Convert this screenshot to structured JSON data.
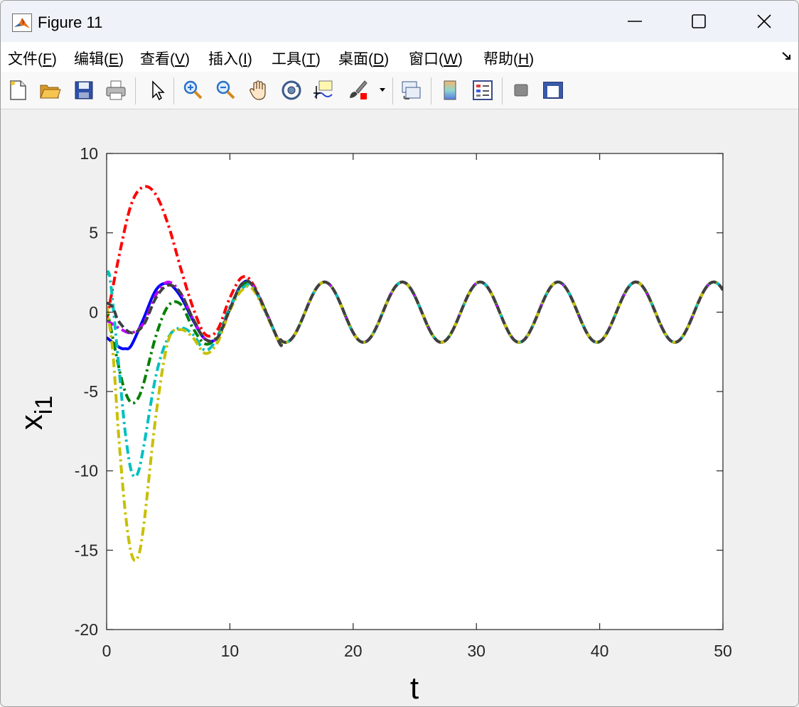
{
  "window": {
    "title": "Figure 11",
    "menu": [
      {
        "label": "文件(",
        "key": "F",
        "suffix": ")"
      },
      {
        "label": "编辑(",
        "key": "E",
        "suffix": ")"
      },
      {
        "label": "查看(",
        "key": "V",
        "suffix": ")"
      },
      {
        "label": "插入(",
        "key": "I",
        "suffix": ")"
      },
      {
        "label": "工具(",
        "key": "T",
        "suffix": ")"
      },
      {
        "label": "桌面(",
        "key": "D",
        "suffix": ")"
      },
      {
        "label": "窗口(",
        "key": "W",
        "suffix": ")"
      },
      {
        "label": "帮助(",
        "key": "H",
        "suffix": ")"
      }
    ],
    "toolbar_icons": [
      "new-figure-icon",
      "open-folder-icon",
      "save-icon",
      "print-icon",
      "pointer-icon",
      "zoom-in-icon",
      "zoom-out-icon",
      "pan-hand-icon",
      "rotate-3d-icon",
      "data-cursor-icon",
      "brush-icon",
      "link-plot-icon",
      "colorbar-icon",
      "legend-icon",
      "hide-plot-tools-icon",
      "show-plot-tools-icon"
    ]
  },
  "chart_data": {
    "type": "line",
    "title": "",
    "xlabel": "t",
    "ylabel": "x",
    "ylabel_subscript": "i1",
    "xlim": [
      0,
      50
    ],
    "ylim": [
      -20,
      10
    ],
    "xticks": [
      "0",
      "10",
      "20",
      "30",
      "40",
      "50"
    ],
    "yticks": [
      "10",
      "5",
      "0",
      "-5",
      "-10",
      "-15",
      "-20"
    ],
    "grid": false,
    "legend": "none",
    "reference_signal": {
      "amplitude": 1.9,
      "angular_frequency": 0.995,
      "phase": -3.45
    },
    "series": [
      {
        "color": "#ff0000",
        "style": "dash-dot",
        "x": [
          0,
          1,
          2,
          3,
          4,
          5,
          6,
          7,
          8,
          9,
          10,
          11,
          12,
          14
        ],
        "y": [
          -0.5,
          3.5,
          6.8,
          7.9,
          7.4,
          5.5,
          2.8,
          0.3,
          -1.4,
          -1.1,
          0.9,
          2.2,
          1.6,
          -1.9
        ]
      },
      {
        "color": "#0000ff",
        "style": "solid",
        "x": [
          0,
          1,
          1.5,
          2,
          3,
          4,
          5,
          6,
          7,
          8,
          9,
          10,
          11,
          12,
          14
        ],
        "y": [
          -1.6,
          -2.2,
          -2.3,
          -2.1,
          -0.4,
          1.4,
          1.8,
          1.0,
          -0.5,
          -1.7,
          -1.6,
          0.2,
          1.8,
          1.5,
          -1.9
        ]
      },
      {
        "color": "#c000ff",
        "style": "dash-dot",
        "x": [
          0,
          1,
          2,
          3,
          4,
          5,
          6,
          7,
          8,
          9,
          10,
          11,
          12,
          14
        ],
        "y": [
          -0.5,
          -1.0,
          -1.3,
          -0.7,
          1.1,
          1.9,
          1.2,
          -0.4,
          -1.7,
          -1.6,
          0.2,
          1.8,
          1.5,
          -1.9
        ]
      },
      {
        "color": "#008000",
        "style": "dash-dot",
        "x": [
          0,
          1,
          1.5,
          2,
          2.5,
          3,
          4,
          5,
          6,
          7,
          8,
          9,
          10,
          11,
          12,
          14
        ],
        "y": [
          0.3,
          -3.5,
          -5.0,
          -5.7,
          -5.5,
          -4.5,
          -1.5,
          0.4,
          0.5,
          -1.0,
          -2.0,
          -1.5,
          0.3,
          1.7,
          1.5,
          -1.9
        ]
      },
      {
        "color": "#00c0c0",
        "style": "dash-dot",
        "x": [
          0,
          0.3,
          1,
          1.5,
          2,
          2.5,
          3,
          4,
          5,
          6,
          7,
          8,
          9,
          10,
          11,
          12,
          14
        ],
        "y": [
          2.4,
          2.0,
          -3.5,
          -7.5,
          -10.0,
          -10.2,
          -8.5,
          -4.0,
          -1.6,
          -1.0,
          -1.4,
          -2.4,
          -1.6,
          0.3,
          1.5,
          1.4,
          -1.9
        ]
      },
      {
        "color": "#c8c000",
        "style": "dash-dot",
        "x": [
          0,
          0.5,
          1,
          1.5,
          2,
          2.5,
          3,
          4,
          5,
          6,
          7,
          8,
          9,
          10,
          11,
          12,
          14
        ],
        "y": [
          0.4,
          -2.5,
          -8.0,
          -12.5,
          -15.2,
          -15.5,
          -13.5,
          -6.5,
          -1.8,
          -1.1,
          -1.6,
          -2.6,
          -1.9,
          0.1,
          1.4,
          1.3,
          -1.9
        ]
      },
      {
        "color": "#404040",
        "style": "dashed",
        "x": [
          0,
          0.5,
          1,
          2,
          3,
          4,
          5,
          6,
          7,
          8,
          9,
          10,
          11,
          12,
          14
        ],
        "y": [
          0.6,
          0.3,
          -0.6,
          -1.3,
          -0.8,
          0.9,
          1.7,
          1.2,
          -0.4,
          -1.7,
          -1.6,
          0.2,
          1.8,
          1.5,
          -1.9
        ]
      }
    ]
  }
}
